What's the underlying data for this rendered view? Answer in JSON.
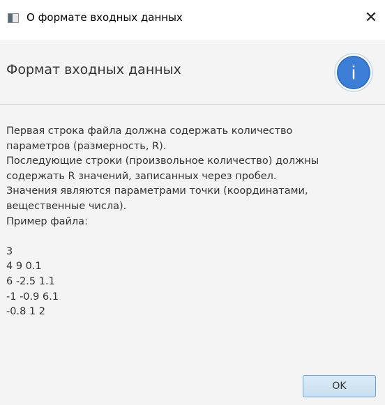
{
  "window": {
    "title": "О формате входных данных",
    "close_glyph": "✕"
  },
  "header": {
    "title": "Формат входных данных",
    "icon": "info-icon",
    "icon_glyph": "i",
    "icon_color": "#2f6fc9"
  },
  "message": {
    "lines": [
      "Первая строка файла должна содержать количество",
      "параметров (размерность, R).",
      "Последующие строки (произвольное количество) должны",
      "содержать R значений, записанных через пробел.",
      "Значения являются параметрами точки (координатами,",
      "вещественные числа).",
      "Пример файла:",
      "",
      "3",
      "4 9 0.1",
      "6 -2.5 1.1",
      "-1 -0.9 6.1",
      "-0.8 1 2"
    ]
  },
  "buttons": {
    "ok_label": "OK"
  },
  "colors": {
    "accent": "#2f6fc9",
    "button_border": "#63a5d9"
  }
}
